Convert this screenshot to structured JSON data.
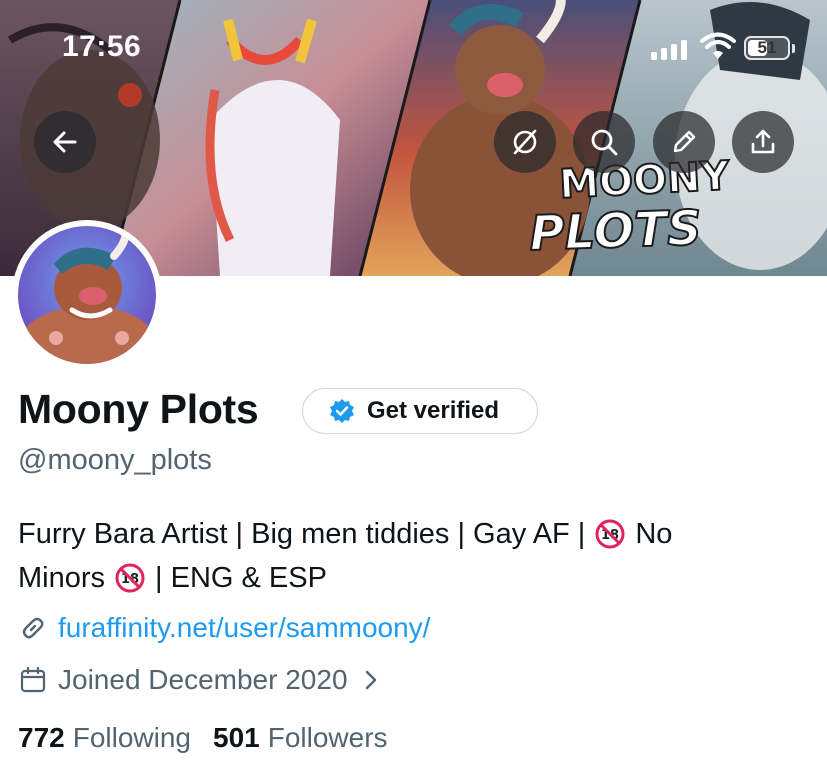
{
  "status_bar": {
    "time": "17:56",
    "battery_percent": "51",
    "battery_level": 0.51
  },
  "banner": {
    "watermark_text": "MOONY PLOTS"
  },
  "header_actions": {
    "back_icon": "arrow-left-icon",
    "mute_icon": "slash-circle-icon",
    "search_icon": "search-icon",
    "edit_icon": "pencil-icon",
    "share_icon": "share-icon"
  },
  "profile": {
    "display_name": "Moony Plots",
    "handle": "@moony_plots",
    "verify_button_label": "Get verified",
    "bio_line_1_a": "Furry Bara Artist | Big men tiddies | Gay AF |",
    "bio_line_1_b": "No",
    "bio_line_2_a": "Minors",
    "bio_line_2_b": "| ENG & ESP",
    "website": "furaffinity.net/user/sammoony/",
    "joined": "Joined December 2020",
    "following_count": "772",
    "following_label": "Following",
    "followers_count": "501",
    "followers_label": "Followers"
  },
  "colors": {
    "link": "#1d9bf0",
    "secondary_text": "#536471",
    "primary_text": "#0f1419",
    "verified_badge": "#1d9bf0"
  }
}
